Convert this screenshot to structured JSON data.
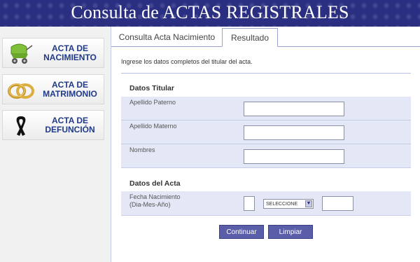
{
  "header": {
    "title": "Consulta de ACTAS REGISTRALES"
  },
  "sidebar": {
    "items": [
      {
        "line1": "ACTA DE",
        "line2": "NACIMIENTO",
        "icon": "stroller-icon"
      },
      {
        "line1": "ACTA DE",
        "line2": "MATRIMONIO",
        "icon": "wedding-rings-icon"
      },
      {
        "line1": "ACTA DE",
        "line2": "DEFUNCIÓN",
        "icon": "mourning-ribbon-icon"
      }
    ]
  },
  "tabs": [
    {
      "label": "Consulta Acta Nacimiento"
    },
    {
      "label": "Resultado"
    }
  ],
  "form": {
    "intro": "Ingrese los datos completos del titular del acta.",
    "section_titular": "Datos Titular",
    "apellido_paterno_label": "Apellido Paterno",
    "apellido_materno_label": "Apellido Materno",
    "nombres_label": "Nombres",
    "apellido_paterno_value": "",
    "apellido_materno_value": "",
    "nombres_value": "",
    "section_acta": "Datos del Acta",
    "fecha_label_line1": "Fecha Nacimiento",
    "fecha_label_line2": "(Dia-Mes-Año)",
    "dia_value": "",
    "mes_selected": "SELECCIONE",
    "anio_value": ""
  },
  "buttons": {
    "continuar": "Continuar",
    "limpiar": "Limpiar"
  },
  "colors": {
    "header_bg": "#2b2f82",
    "accent_text": "#1f3a8a",
    "row_bg": "#e4e8f6",
    "button_bg": "#5a5ea9"
  }
}
